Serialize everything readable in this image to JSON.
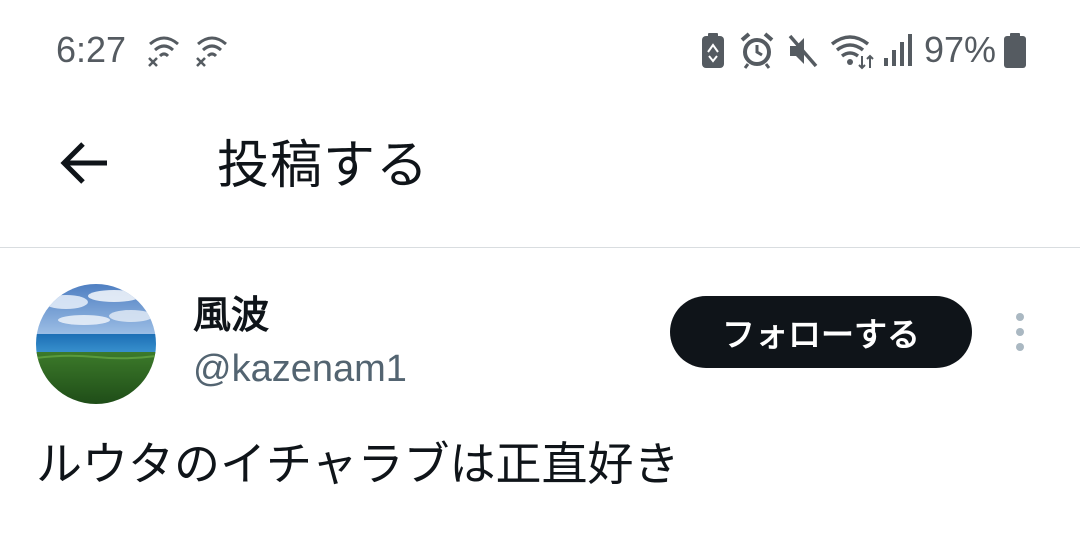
{
  "status_bar": {
    "time": "6:27",
    "battery_percent": "97%",
    "left_icons": [
      "wifi-off-icon",
      "wifi-off-icon"
    ],
    "right_icons": [
      "battery-saver-icon",
      "alarm-icon",
      "mute-icon",
      "wifi-data-icon",
      "signal-icon",
      "battery-icon"
    ]
  },
  "header": {
    "title": "投稿する",
    "back_icon": "back-arrow-icon"
  },
  "post": {
    "author": {
      "display_name": "風波",
      "handle": "@kazenam1",
      "avatar": "avatar-sea-grass"
    },
    "follow_label": "フォローする",
    "more_icon": "more-vertical-icon",
    "text": "ルウタのイチャラブは正直好き"
  },
  "colors": {
    "text_primary": "#0f1419",
    "text_secondary": "#536471",
    "status_text": "#555b61",
    "follow_bg": "#0f1419",
    "follow_text": "#ffffff",
    "divider": "#d9dde0"
  }
}
